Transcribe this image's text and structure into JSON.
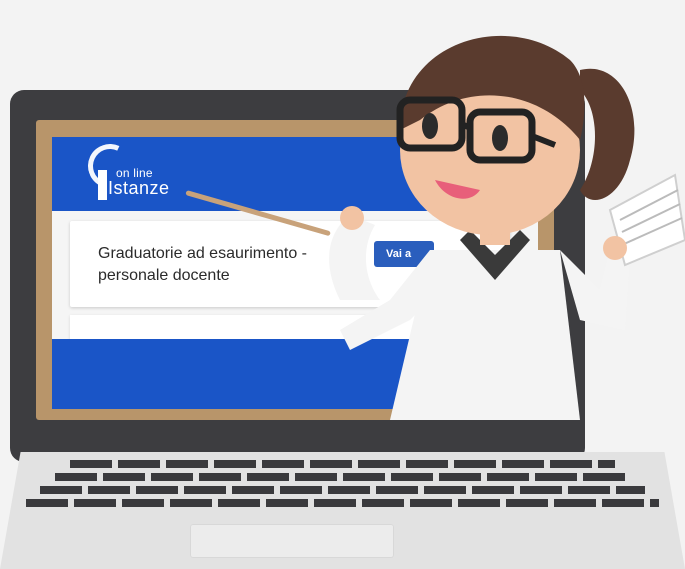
{
  "app": {
    "logo_line1": "on line",
    "logo_line2": "Istanze"
  },
  "card": {
    "title": "Graduatorie ad esaurimento - personale docente",
    "button_label": "Vai a"
  },
  "colors": {
    "header_blue": "#1a55c7",
    "button_blue": "#2a5ebd",
    "frame_wood": "#b8956a"
  },
  "icons": {
    "logo": "online-istanze-logo",
    "illustration": "teacher-illustration"
  }
}
